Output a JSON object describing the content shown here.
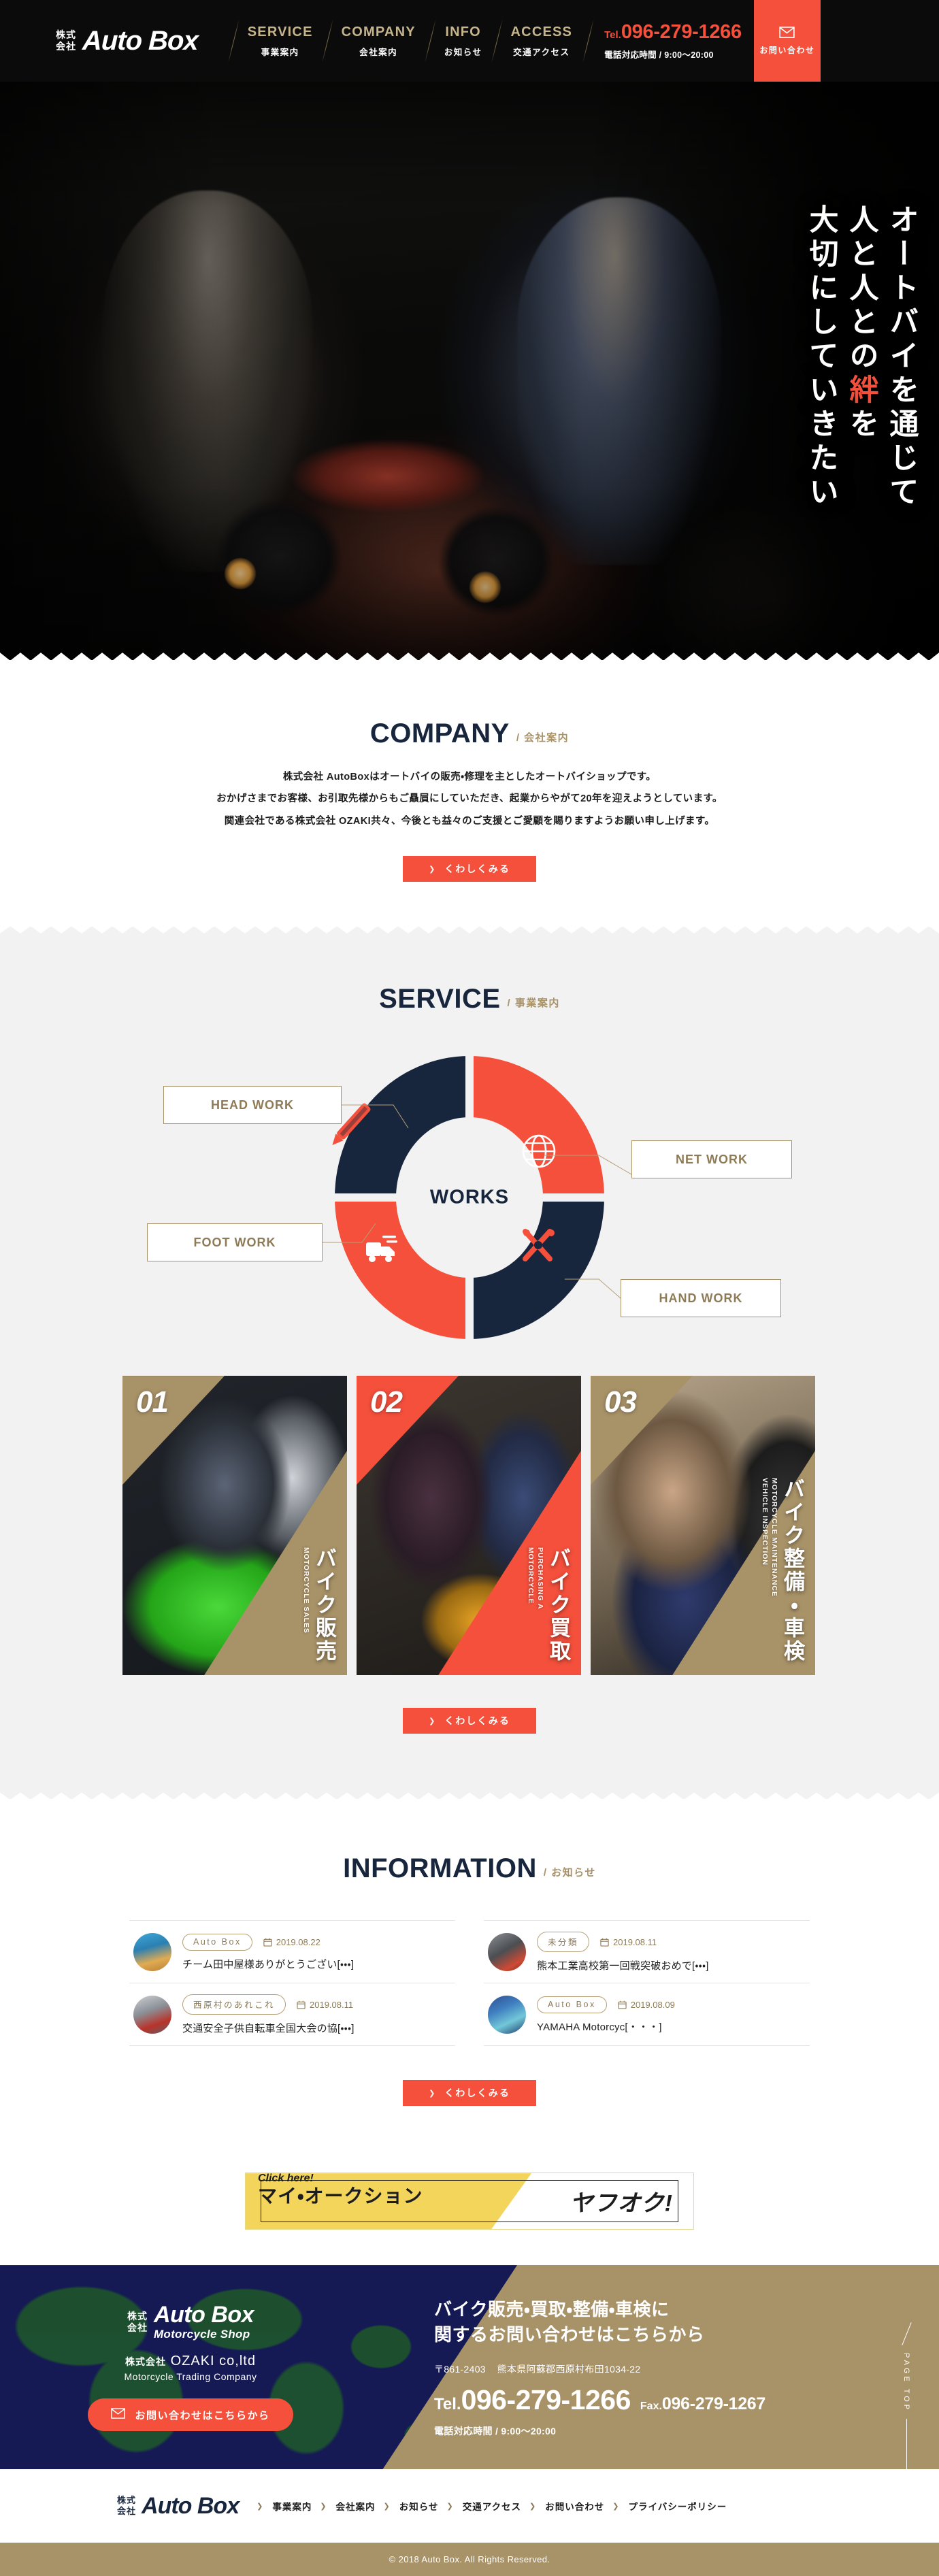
{
  "header": {
    "logo": {
      "kanji_line1": "株式",
      "kanji_line2": "会社",
      "word": "Auto Box"
    },
    "nav": [
      {
        "en": "SERVICE",
        "jp": "事業案内"
      },
      {
        "en": "COMPANY",
        "jp": "会社案内"
      },
      {
        "en": "INFO",
        "jp": "お知らせ"
      },
      {
        "en": "ACCESS",
        "jp": "交通アクセス"
      }
    ],
    "tel_prefix": "Tel.",
    "tel_number": "096-279-1266",
    "tel_hours": "電話対応時間 / 9:00〜20:00",
    "contact_label": "お問い合わせ",
    "contact_icon": "mail-icon",
    "accent_color": "#F4503C",
    "background_color": "#0b0b0b"
  },
  "hero": {
    "line1": "オートバイを通じて",
    "line2_a": "人と人との",
    "line2_kizuna": "絆",
    "line2_b": "を",
    "line3": "大切にしていきたい",
    "highlight_color": "#F4503C"
  },
  "company": {
    "heading_en": "COMPANY",
    "heading_jp": "/ 会社案内",
    "paragraphs": [
      "株式会社 AutoBoxはオートバイの販売・修理を主としたオートバイショップです。",
      "おかげさまでお客様、お引取先様からもご贔屓にしていただき、起業からやがて20年を迎えようとしています。",
      "関連会社である株式会社 OZAKI共々、今後とも益々のご支援とご愛顧を賜りますようお願い申し上げます。"
    ],
    "button_label": "くわしくみる"
  },
  "service": {
    "heading_en": "SERVICE",
    "heading_jp": "/ 事業案内",
    "works_center": "WORKS",
    "works_labels": [
      {
        "label": "HEAD WORK",
        "icon": "pencil-icon",
        "segment_color": "#17253D"
      },
      {
        "label": "NET WORK",
        "icon": "globe-icon",
        "segment_color": "#F4503C"
      },
      {
        "label": "HAND WORK",
        "icon": "tools-icon",
        "segment_color": "#17253D"
      },
      {
        "label": "FOOT WORK",
        "icon": "truck-icon",
        "segment_color": "#F4503C"
      }
    ],
    "cards": [
      {
        "num": "01",
        "jp": "バイク販売",
        "en": "MOTORCYCLE SALES",
        "accent": "#A89268"
      },
      {
        "num": "02",
        "jp": "バイク買取",
        "en": "PURCHASING A\nMOTORCYCLE",
        "accent": "#F4503C"
      },
      {
        "num": "03",
        "jp": "バイク整備・車検",
        "en": "MOTORCYCLE MAINTENANCE\nVEHICLE INSPECTION",
        "accent": "#A89268"
      }
    ],
    "button_label": "くわしくみる",
    "background_color": "#F2F2F2"
  },
  "information": {
    "heading_en": "INFORMATION",
    "heading_jp": "/ お知らせ",
    "items": [
      {
        "category": "Auto Box",
        "date": "2019.08.22",
        "title": "チーム田中屋様ありがとうござい[・・・]",
        "thumb": "thumb-a"
      },
      {
        "category": "未分類",
        "date": "2019.08.11",
        "title": "熊本工業高校第一回戦突破おめで[・・・]",
        "thumb": "thumb-b"
      },
      {
        "category": "西原村のあれこれ",
        "date": "2019.08.11",
        "title": "交通安全子供自転車全国大会の協[・・・]",
        "thumb": "thumb-c"
      },
      {
        "category": "Auto Box",
        "date": "2019.08.09",
        "title": "YAMAHA Motorcyc[・・・]",
        "thumb": "thumb-d"
      }
    ],
    "button_label": "くわしくみる",
    "date_icon": "calendar-icon"
  },
  "yahoo_banner": {
    "click_here": "Click here!",
    "my_auction": "マイ・オークション",
    "yahuoku": "ヤフオク!",
    "background_color": "#F4D55C"
  },
  "footer_contact": {
    "logo": {
      "kanji_line1": "株式",
      "kanji_line2": "会社",
      "word": "Auto Box",
      "sub": "Motorcycle Shop"
    },
    "ozaki_kanji": "株式会社",
    "ozaki_name": "OZAKI co,ltd",
    "ozaki_sub": "Motorcycle Trading Company",
    "contact_button": "お問い合わせはこちらから",
    "contact_icon": "mail-icon",
    "heading_line1": "バイク販売・買取・整備・車検に",
    "heading_line2": "関するお問い合わせはこちらから",
    "postal": "〒861-2403",
    "address": "熊本県阿蘇郡西原村布田1034-22",
    "tel_prefix": "Tel.",
    "tel_number": "096-279-1266",
    "fax_prefix": "Fax.",
    "fax_number": "096-279-1267",
    "hours": "電話対応時間 / 9:00〜20:00",
    "pagetop": "PAGE TOP",
    "left_bg": "#151A54",
    "right_bg": "#A89268"
  },
  "footer_nav": {
    "logo": {
      "kanji_line1": "株式",
      "kanji_line2": "会社",
      "word": "Auto Box"
    },
    "links": [
      "事業案内",
      "会社案内",
      "お知らせ",
      "交通アクセス",
      "お問い合わせ",
      "プライバシーポリシー"
    ],
    "copyright": "© 2018 Auto Box. All Rights Reserved."
  }
}
